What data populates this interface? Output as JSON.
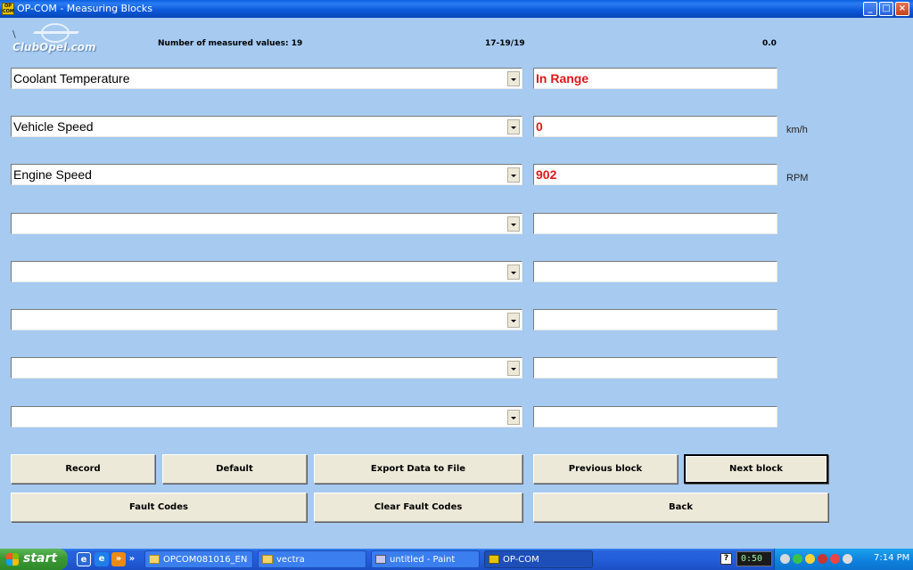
{
  "window": {
    "title": "OP-COM - Measuring Blocks",
    "app_icon_text": "OP COM",
    "minimize": "_",
    "maximize": "□",
    "close": "×"
  },
  "header": {
    "logo_text": "ClubOpel.com",
    "measured_values": "Number of measured values: 19",
    "range": "17-19/19",
    "elapsed": "0.0"
  },
  "rows": [
    {
      "label": "Coolant Temperature",
      "value": "In Range",
      "unit": ""
    },
    {
      "label": "Vehicle Speed",
      "value": "0",
      "unit": "km/h"
    },
    {
      "label": "Engine Speed",
      "value": "902",
      "unit": "RPM"
    },
    {
      "label": "",
      "value": "",
      "unit": ""
    },
    {
      "label": "",
      "value": "",
      "unit": ""
    },
    {
      "label": "",
      "value": "",
      "unit": ""
    },
    {
      "label": "",
      "value": "",
      "unit": ""
    },
    {
      "label": "",
      "value": "",
      "unit": ""
    }
  ],
  "buttons": {
    "record": "Record",
    "default": "Default",
    "export": "Export Data to File",
    "previous_block": "Previous block",
    "next_block": "Next block",
    "fault_codes": "Fault Codes",
    "clear_fault_codes": "Clear Fault Codes",
    "back": "Back"
  },
  "taskbar": {
    "start": "start",
    "tasks": [
      "OPCOM081016_EN",
      "vectra",
      "untitled - Paint",
      "OP-COM"
    ],
    "help": "?",
    "timer": "0:50",
    "clock": "7:14 PM"
  },
  "colors": {
    "background": "#a6caf0",
    "value_text": "#e01818",
    "titlebar": "#0b58d8",
    "taskbar": "#245edb"
  }
}
